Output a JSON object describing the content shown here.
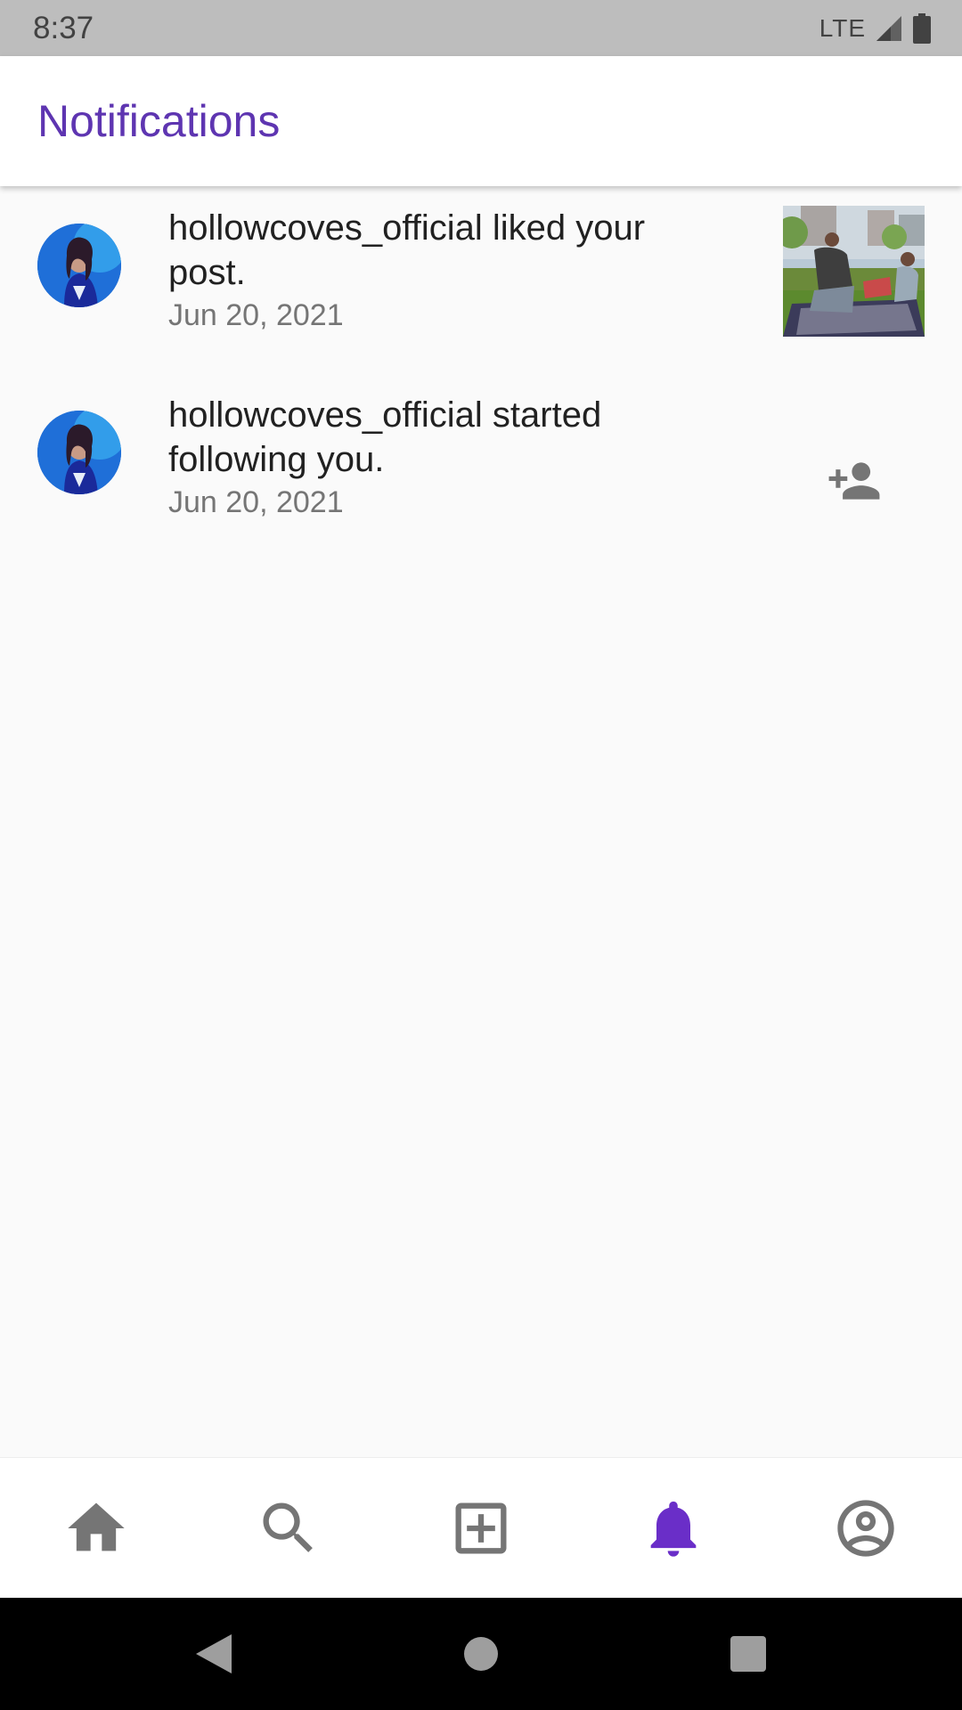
{
  "status_bar": {
    "time": "8:37",
    "network": "LTE"
  },
  "header": {
    "title": "Notifications"
  },
  "notifications": [
    {
      "username": "hollowcoves_official",
      "action": " liked your post.",
      "date": "Jun 20, 2021",
      "trailing": "post-thumbnail"
    },
    {
      "username": "hollowcoves_official",
      "action": " started following you.",
      "date": "Jun 20, 2021",
      "trailing": "person-add-icon"
    }
  ],
  "bottom_nav": {
    "items": [
      {
        "icon": "home-icon"
      },
      {
        "icon": "search-icon"
      },
      {
        "icon": "add-box-icon"
      },
      {
        "icon": "notifications-bell-icon",
        "active": true
      },
      {
        "icon": "account-circle-icon"
      }
    ],
    "active_color": "#6a2ec8",
    "inactive_color": "#757575"
  },
  "colors": {
    "title": "#5e35b1",
    "username": "#212121",
    "date": "#757575"
  }
}
